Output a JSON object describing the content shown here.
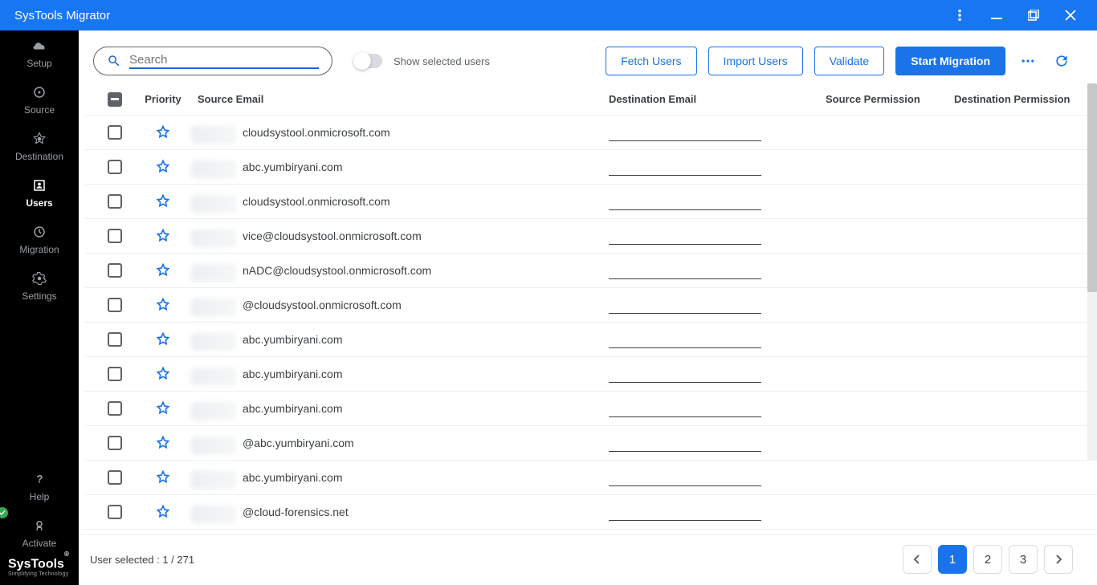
{
  "title": "SysTools Migrator",
  "sidebar": {
    "items": [
      {
        "label": "Setup"
      },
      {
        "label": "Source"
      },
      {
        "label": "Destination"
      },
      {
        "label": "Users"
      },
      {
        "label": "Migration"
      },
      {
        "label": "Settings"
      }
    ],
    "help": "Help",
    "activate": "Activate"
  },
  "brand": {
    "line1": "SysTools",
    "line2": "Simplifying Technology"
  },
  "toolbar": {
    "search_placeholder": "Search",
    "toggle_label": "Show selected users",
    "fetch": "Fetch Users",
    "import": "Import Users",
    "validate": "Validate",
    "start": "Start Migration"
  },
  "columns": {
    "priority": "Priority",
    "source": "Source Email",
    "destination": "Destination Email",
    "sp": "Source Permission",
    "dp": "Destination Permission"
  },
  "rows": [
    {
      "src": "cloudsystool.onmicrosoft.com"
    },
    {
      "src": "abc.yumbiryani.com"
    },
    {
      "src": "cloudsystool.onmicrosoft.com"
    },
    {
      "src": "vice@cloudsystool.onmicrosoft.com"
    },
    {
      "src": "nADC@cloudsystool.onmicrosoft.com"
    },
    {
      "src": "@cloudsystool.onmicrosoft.com"
    },
    {
      "src": "abc.yumbiryani.com"
    },
    {
      "src": "abc.yumbiryani.com"
    },
    {
      "src": "abc.yumbiryani.com"
    },
    {
      "src": "@abc.yumbiryani.com"
    },
    {
      "src": "abc.yumbiryani.com"
    },
    {
      "src": "@cloud-forensics.net"
    }
  ],
  "footer": {
    "selected": "User selected : 1 / 271",
    "pages": [
      "1",
      "2",
      "3"
    ]
  }
}
